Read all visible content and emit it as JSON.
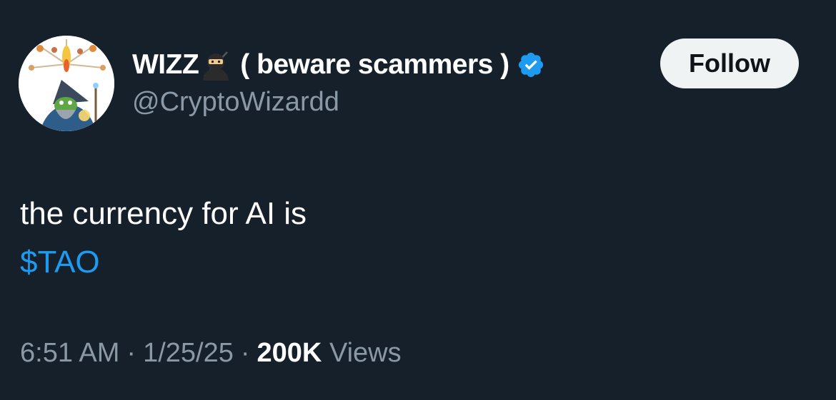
{
  "tweet": {
    "display_name": "WIZZ",
    "name_suffix": "( beware scammers )",
    "handle": "@CryptoWizardd",
    "follow_label": "Follow",
    "text_line1": "the currency for AI is",
    "cashtag": "$TAO",
    "time": "6:51 AM",
    "separator": "·",
    "date": "1/25/25",
    "views_count": "200K",
    "views_label": "Views"
  },
  "icons": {
    "ninja": "ninja-emoji-icon",
    "verified": "verified-badge-icon"
  },
  "colors": {
    "background": "#15202b",
    "text": "#ffffff",
    "secondary_text": "#8b98a5",
    "link": "#1d9bf0",
    "verified": "#1d9bf0",
    "follow_button_bg": "#eff3f4",
    "follow_button_text": "#0f1419"
  }
}
